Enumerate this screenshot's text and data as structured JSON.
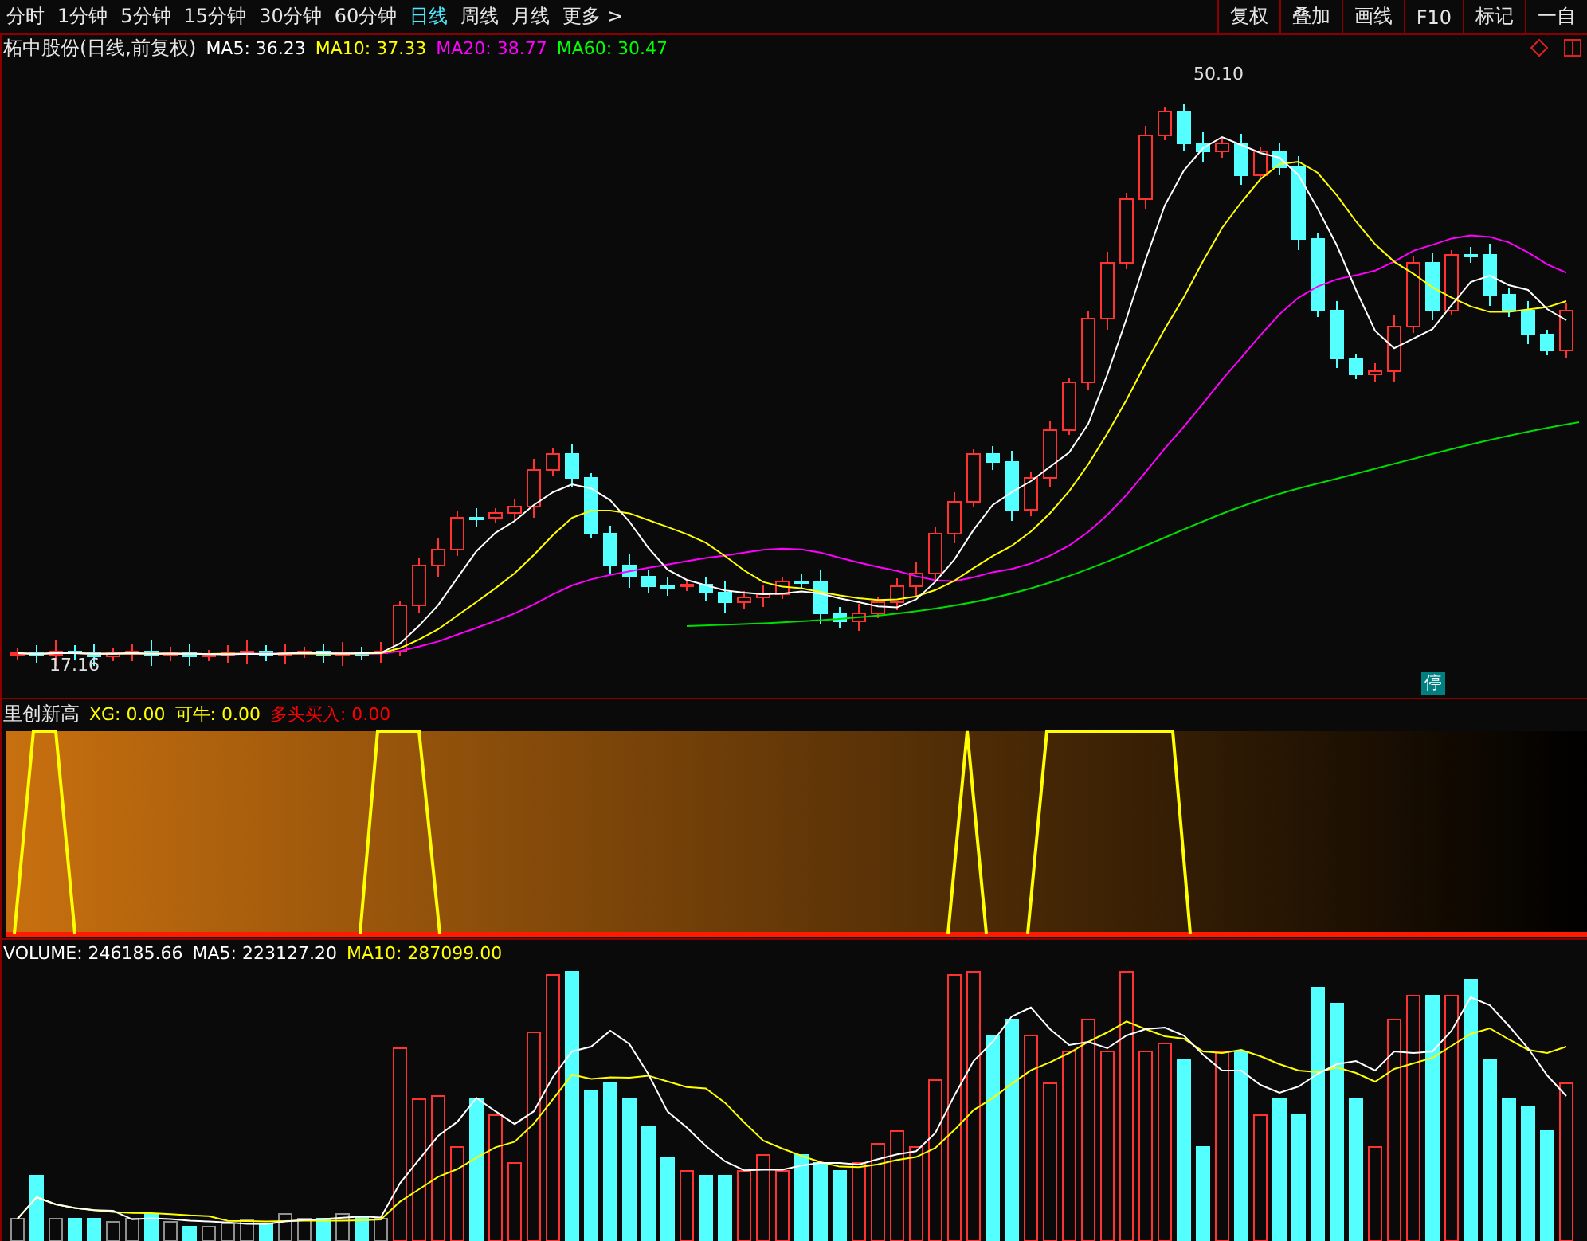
{
  "toolbar": {
    "periods": [
      {
        "label": "分时",
        "selected": false
      },
      {
        "label": "1分钟",
        "selected": false
      },
      {
        "label": "5分钟",
        "selected": false
      },
      {
        "label": "15分钟",
        "selected": false
      },
      {
        "label": "30分钟",
        "selected": false
      },
      {
        "label": "60分钟",
        "selected": false
      },
      {
        "label": "日线",
        "selected": true
      },
      {
        "label": "周线",
        "selected": false
      },
      {
        "label": "月线",
        "selected": false
      }
    ],
    "more": {
      "label": "更多",
      "arrow": ">"
    },
    "buttons": [
      "复权",
      "叠加",
      "画线",
      "F10",
      "标记",
      "一自"
    ]
  },
  "price_panel": {
    "title": "柘中股份(日线,前复权)",
    "indicators": [
      {
        "label": "MA5: 36.23",
        "color": "#ffffff"
      },
      {
        "label": "MA10: 37.33",
        "color": "#ffff00"
      },
      {
        "label": "MA20: 38.77",
        "color": "#ff00ff"
      },
      {
        "label": "MA60: 30.47",
        "color": "#00ff00"
      }
    ],
    "high_label": "50.10",
    "low_label": "17.16",
    "suspended_badge": "停"
  },
  "signal_panel": {
    "name": "里创新高",
    "indicators": [
      {
        "label": "XG: 0.00",
        "color": "#ffff00"
      },
      {
        "label": "可牛: 0.00",
        "color": "#ffff00"
      },
      {
        "label": "多头买入: 0.00",
        "color": "#ff0000"
      }
    ]
  },
  "volume_panel": {
    "indicators": [
      {
        "label": "VOLUME: 246185.66",
        "color": "#ffffff"
      },
      {
        "label": "MA5: 223127.20",
        "color": "#ffffff"
      },
      {
        "label": "MA10: 287099.00",
        "color": "#ffff00"
      }
    ]
  }
}
